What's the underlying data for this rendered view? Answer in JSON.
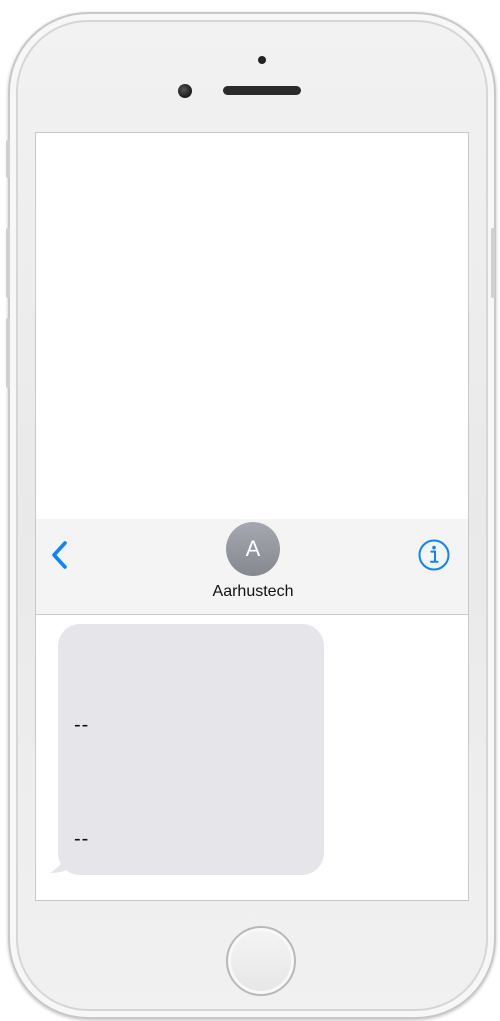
{
  "conversation": {
    "contact_initial": "A",
    "contact_name": "Aarhustech",
    "accent_color": "#0a84ff",
    "back_icon": "chevron-left-icon",
    "info_icon": "info-circle-icon"
  },
  "message": {
    "lines": [
      "--",
      "--"
    ],
    "bubble_color": "#e5e5ea"
  }
}
